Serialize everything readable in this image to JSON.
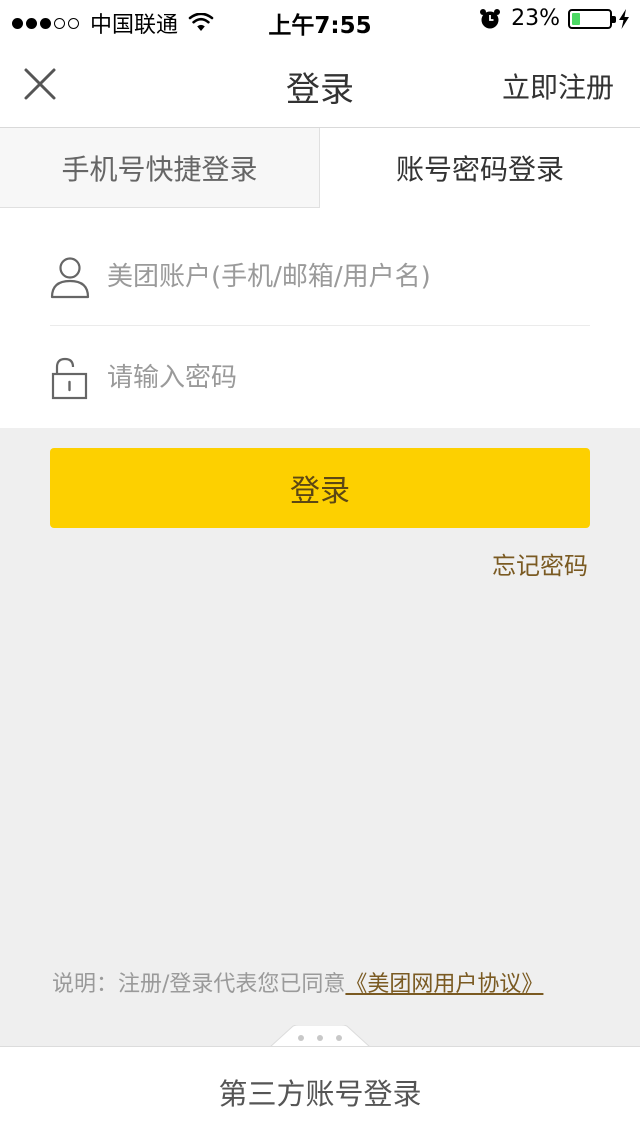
{
  "status_bar": {
    "signal_full": 3,
    "signal_empty": 2,
    "carrier": "中国联通",
    "time": "上午7:55",
    "battery_percent": "23%",
    "battery_level": 0.23,
    "icons": [
      "wifi-icon",
      "alarm-icon",
      "battery-icon",
      "charging-icon"
    ]
  },
  "nav": {
    "close_icon": "close-icon",
    "title": "登录",
    "register_label": "立即注册"
  },
  "tabs": [
    {
      "label": "手机号快捷登录",
      "active": false
    },
    {
      "label": "账号密码登录",
      "active": true
    }
  ],
  "form": {
    "account_placeholder": "美团账户(手机/邮箱/用户名)",
    "account_value": "",
    "account_icon": "user-icon",
    "password_placeholder": "请输入密码",
    "password_value": "",
    "password_icon": "unlock-icon"
  },
  "actions": {
    "login_label": "登录",
    "forgot_label": "忘记密码"
  },
  "agreement": {
    "text": "说明：注册/登录代表您已同意",
    "link": "《美团网用户协议》"
  },
  "third_party": {
    "label": "第三方账号登录",
    "expand_icon": "more-dots-icon"
  },
  "colors": {
    "accent": "#fdd000",
    "accent_text": "#5c4714",
    "link": "#7a5a22",
    "background": "#efefef"
  }
}
